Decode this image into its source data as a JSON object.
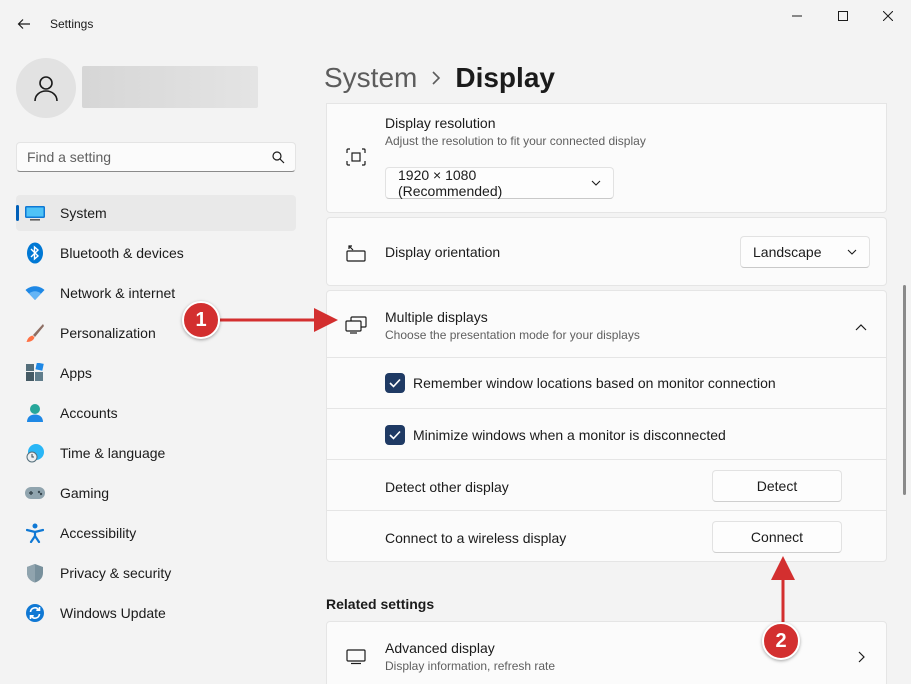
{
  "window": {
    "title": "Settings"
  },
  "sidebar": {
    "search_placeholder": "Find a setting",
    "items": [
      {
        "label": "System",
        "icon": "system-monitor-icon",
        "active": true
      },
      {
        "label": "Bluetooth & devices",
        "icon": "bluetooth-icon"
      },
      {
        "label": "Network & internet",
        "icon": "wifi-icon"
      },
      {
        "label": "Personalization",
        "icon": "paintbrush-icon"
      },
      {
        "label": "Apps",
        "icon": "apps-icon"
      },
      {
        "label": "Accounts",
        "icon": "person-icon"
      },
      {
        "label": "Time & language",
        "icon": "globe-clock-icon"
      },
      {
        "label": "Gaming",
        "icon": "gamepad-icon"
      },
      {
        "label": "Accessibility",
        "icon": "accessibility-icon"
      },
      {
        "label": "Privacy & security",
        "icon": "shield-icon"
      },
      {
        "label": "Windows Update",
        "icon": "update-icon"
      }
    ]
  },
  "breadcrumb": {
    "parent": "System",
    "current": "Display"
  },
  "main": {
    "resolution": {
      "title": "Display resolution",
      "subtitle": "Adjust the resolution to fit your connected display",
      "value": "1920 × 1080 (Recommended)"
    },
    "orientation": {
      "title": "Display orientation",
      "value": "Landscape"
    },
    "multiple": {
      "title": "Multiple displays",
      "subtitle": "Choose the presentation mode for your displays",
      "remember_label": "Remember window locations based on monitor connection",
      "remember_checked": true,
      "minimize_label": "Minimize windows when a monitor is disconnected",
      "minimize_checked": true,
      "detect_label": "Detect other display",
      "detect_button": "Detect",
      "connect_label": "Connect to a wireless display",
      "connect_button": "Connect"
    },
    "related_title": "Related settings",
    "advanced": {
      "title": "Advanced display",
      "subtitle": "Display information, refresh rate"
    }
  },
  "annotations": {
    "badge1": "1",
    "badge2": "2",
    "color": "#d32f2f"
  },
  "colors": {
    "accent": "#005fb8",
    "checkbox": "#1f3a64",
    "background": "#f3f3f3",
    "card": "#fbfbfb"
  }
}
